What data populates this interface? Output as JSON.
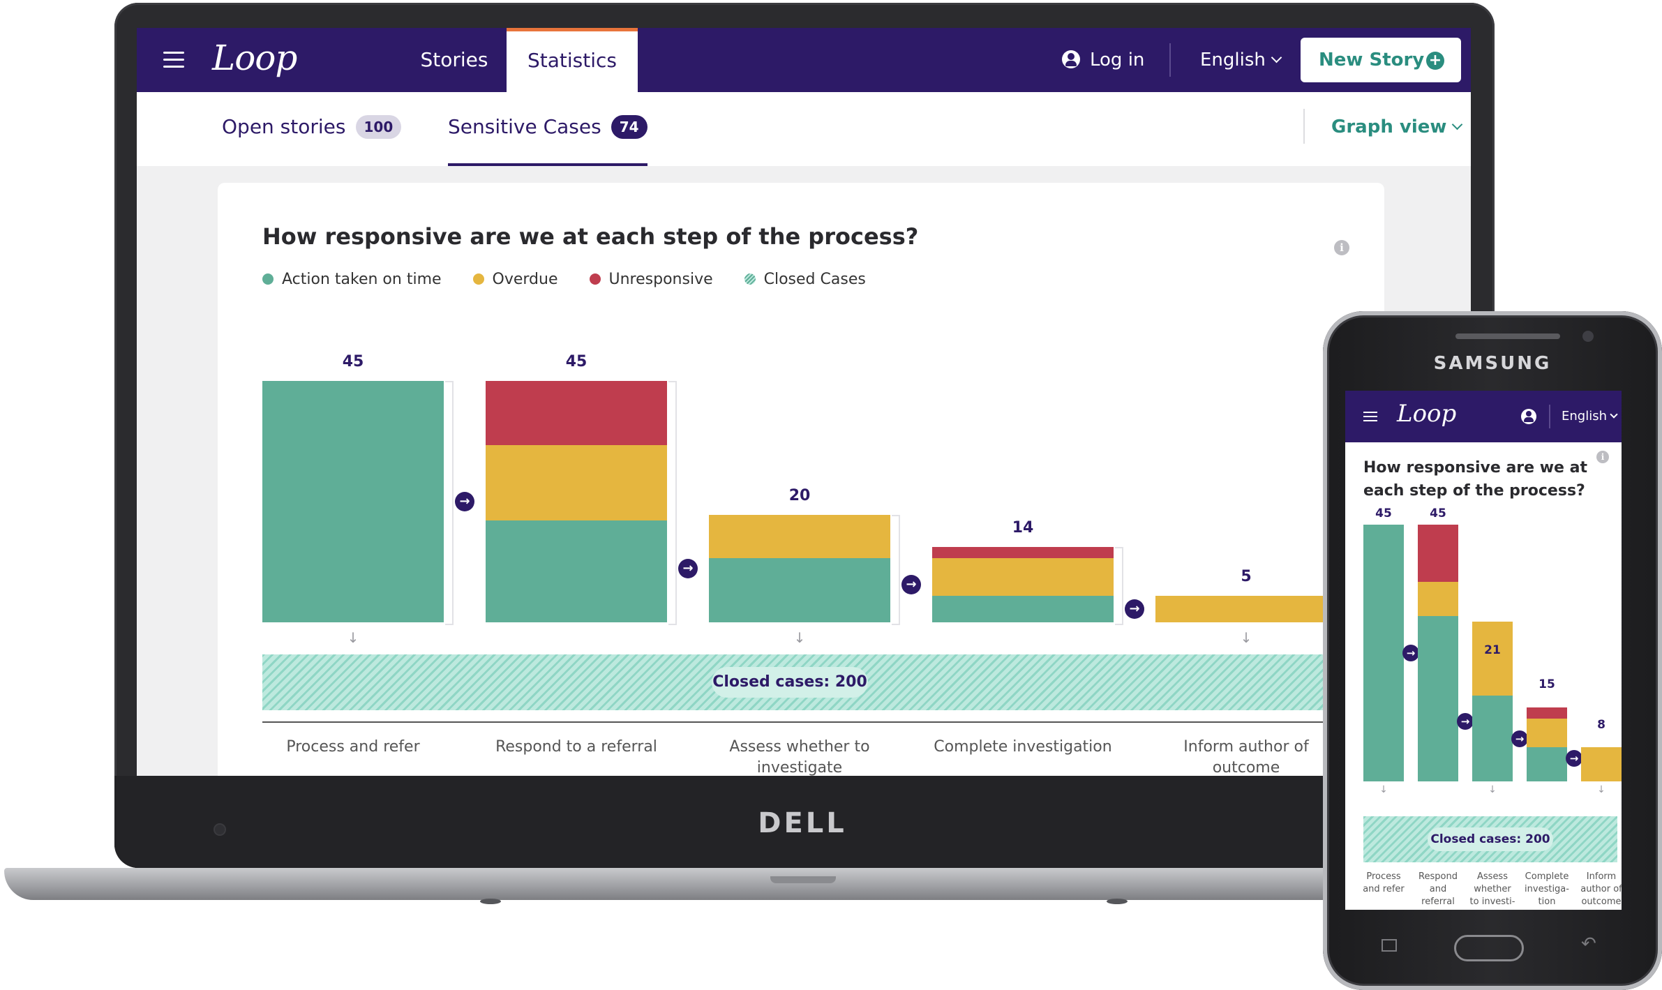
{
  "laptop": {
    "brand": "DELL",
    "app": {
      "logo": "Loop",
      "nav_tabs": [
        {
          "label": "Stories",
          "active": false
        },
        {
          "label": "Statistics",
          "active": true
        }
      ],
      "login_label": "Log in",
      "language": "English",
      "new_story_label": "New Story",
      "sub_tabs": [
        {
          "label": "Open stories",
          "count": "100",
          "active": false
        },
        {
          "label": "Sensitive Cases",
          "count": "74",
          "active": true
        }
      ],
      "view_selector": "Graph view"
    }
  },
  "colors": {
    "action": "#5fae97",
    "overdue": "#e5b63f",
    "unresponsive": "#bf3d4e",
    "brand": "#2d1a67",
    "accent": "#2a8d7f",
    "tab_highlight": "#e8743b"
  },
  "chart_data": [
    {
      "type": "bar",
      "stacked": true,
      "title": "How responsive are we at each step of the process?",
      "legend": [
        "Action taken on time",
        "Overdue",
        "Unresponsive",
        "Closed Cases"
      ],
      "legend_position": "top-left",
      "categories": [
        "Process and refer",
        "Respond to a referral",
        "Assess whether to investigate",
        "Complete investigation",
        "Inform author of outcome"
      ],
      "totals": [
        45,
        45,
        20,
        14,
        5
      ],
      "series": [
        {
          "name": "Action taken on time",
          "values": [
            45,
            19,
            12,
            5,
            0
          ]
        },
        {
          "name": "Overdue",
          "values": [
            0,
            14,
            8,
            7,
            5
          ]
        },
        {
          "name": "Unresponsive",
          "values": [
            0,
            12,
            0,
            2,
            0
          ]
        }
      ],
      "closed_cases_label": "Closed cases: 200",
      "ylim": [
        0,
        45
      ]
    },
    {
      "type": "bar",
      "stacked": true,
      "title": "How responsive are we at each step of the process?",
      "categories": [
        "Process and refer",
        "Respond and referral",
        "Assess whether to investi-",
        "Complete investiga- tion",
        "Inform author of outcome"
      ],
      "totals": [
        45,
        45,
        21,
        15,
        8
      ],
      "series": [
        {
          "name": "Action taken on time",
          "values": [
            45,
            29,
            15,
            6,
            0
          ]
        },
        {
          "name": "Overdue",
          "values": [
            0,
            6,
            13,
            5,
            6
          ]
        },
        {
          "name": "Unresponsive",
          "values": [
            0,
            10,
            0,
            2,
            0
          ]
        }
      ],
      "closed_cases_label": "Closed cases: 200",
      "ylim": [
        0,
        45
      ]
    }
  ],
  "phone": {
    "brand": "SAMSUNG",
    "logo": "Loop",
    "language": "English"
  }
}
